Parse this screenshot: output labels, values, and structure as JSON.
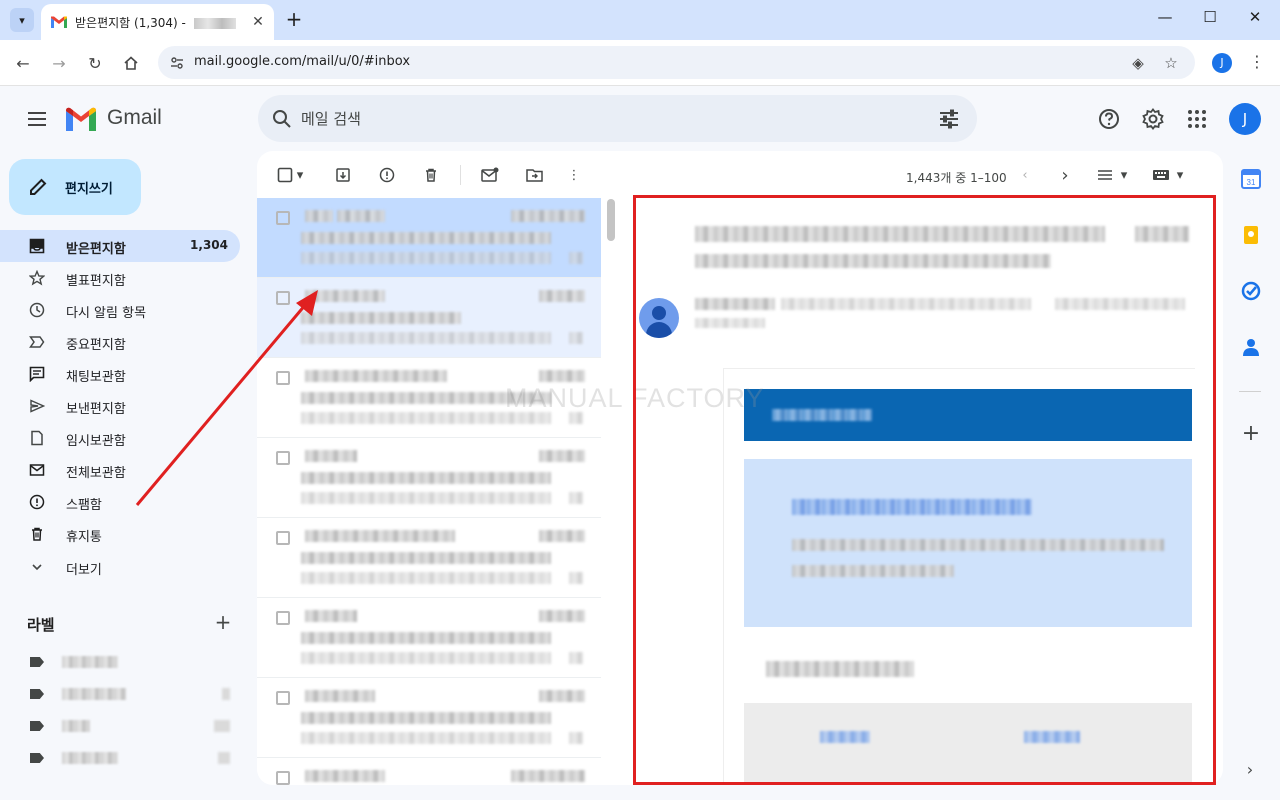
{
  "browser": {
    "tab_title": "받은편지함 (1,304) - ",
    "url": "mail.google.com/mail/u/0/#inbox",
    "profile_initial": "J",
    "new_tab_symbol": "+",
    "close_tab_symbol": "✕",
    "window_controls": {
      "minimize": "—",
      "maximize": "☐",
      "close": "✕"
    }
  },
  "gmail": {
    "logo_text": "Gmail",
    "search_placeholder": "메일 검색",
    "account_initial": "J",
    "compose_label": "편지쓰기",
    "nav": [
      {
        "label": "받은편지함",
        "count": "1,304",
        "icon": "inbox-icon",
        "active": true
      },
      {
        "label": "별표편지함",
        "icon": "star-icon"
      },
      {
        "label": "다시 알림 항목",
        "icon": "clock-icon"
      },
      {
        "label": "중요편지함",
        "icon": "important-icon"
      },
      {
        "label": "채팅보관함",
        "icon": "chat-icon"
      },
      {
        "label": "보낸편지함",
        "icon": "send-icon"
      },
      {
        "label": "임시보관함",
        "icon": "draft-icon"
      },
      {
        "label": "전체보관함",
        "icon": "all-mail-icon"
      },
      {
        "label": "스팸함",
        "icon": "spam-icon"
      },
      {
        "label": "휴지통",
        "icon": "trash-icon"
      },
      {
        "label": "더보기",
        "icon": "chevron-down-icon"
      }
    ],
    "labels_title": "라벨",
    "labels_add_symbol": "+",
    "pager_text": "1,443개 중 1–100",
    "watermark": "MANUAL FACTORY"
  },
  "colors": {
    "annotation_red": "#e02020",
    "accent_blue": "#1a73e8",
    "compose_bg": "#c2e7ff",
    "active_nav_bg": "#d3e3fd"
  }
}
